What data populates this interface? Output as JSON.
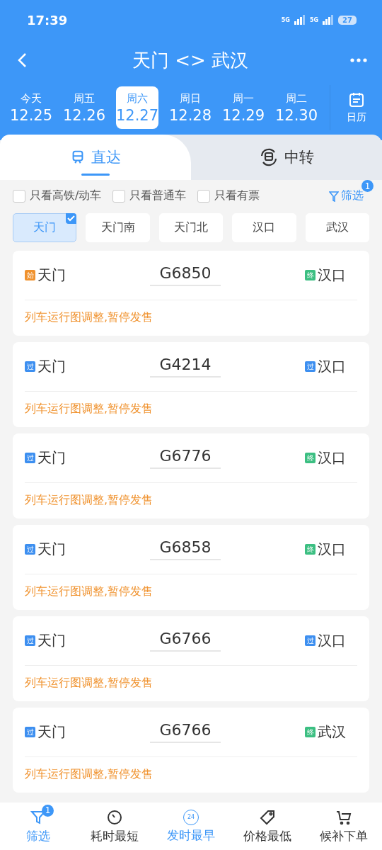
{
  "status_bar": {
    "time": "17:39",
    "network": [
      "5G",
      "5G"
    ],
    "battery": "27"
  },
  "header": {
    "title": "天门 <> 武汉"
  },
  "dates": [
    {
      "weekday": "今天",
      "date": "12.25",
      "selected": false
    },
    {
      "weekday": "周五",
      "date": "12.26",
      "selected": false
    },
    {
      "weekday": "周六",
      "date": "12.27",
      "selected": true
    },
    {
      "weekday": "周日",
      "date": "12.28",
      "selected": false
    },
    {
      "weekday": "周一",
      "date": "12.29",
      "selected": false
    },
    {
      "weekday": "周二",
      "date": "12.30",
      "selected": false
    }
  ],
  "calendar_button": "日历",
  "mode_tabs": [
    {
      "label": "直达",
      "kind": "direct",
      "selected": true
    },
    {
      "label": "中转",
      "kind": "transfer",
      "selected": false
    }
  ],
  "filters": [
    {
      "label": "只看高铁/动车",
      "checked": false
    },
    {
      "label": "只看普通车",
      "checked": false
    },
    {
      "label": "只看有票",
      "checked": false
    }
  ],
  "filter_link": {
    "label": "筛选",
    "badge": "1"
  },
  "stations": [
    {
      "label": "天门",
      "selected": true
    },
    {
      "label": "天门南",
      "selected": false
    },
    {
      "label": "天门北",
      "selected": false
    },
    {
      "label": "汉口",
      "selected": false
    },
    {
      "label": "武汉",
      "selected": false
    }
  ],
  "trains": [
    {
      "from": {
        "badge": "始",
        "color": "#f0922e",
        "name": "天门"
      },
      "number": "G6850",
      "to": {
        "badge": "终",
        "color": "#3cbf82",
        "name": "汉口"
      },
      "notice": "列车运行图调整,暂停发售"
    },
    {
      "from": {
        "badge": "过",
        "color": "#3d8ff0",
        "name": "天门"
      },
      "number": "G4214",
      "to": {
        "badge": "过",
        "color": "#3d8ff0",
        "name": "汉口"
      },
      "notice": "列车运行图调整,暂停发售"
    },
    {
      "from": {
        "badge": "过",
        "color": "#3d8ff0",
        "name": "天门"
      },
      "number": "G6776",
      "to": {
        "badge": "终",
        "color": "#3cbf82",
        "name": "汉口"
      },
      "notice": "列车运行图调整,暂停发售"
    },
    {
      "from": {
        "badge": "过",
        "color": "#3d8ff0",
        "name": "天门"
      },
      "number": "G6858",
      "to": {
        "badge": "终",
        "color": "#3cbf82",
        "name": "汉口"
      },
      "notice": "列车运行图调整,暂停发售"
    },
    {
      "from": {
        "badge": "过",
        "color": "#3d8ff0",
        "name": "天门"
      },
      "number": "G6766",
      "to": {
        "badge": "过",
        "color": "#3d8ff0",
        "name": "汉口"
      },
      "notice": "列车运行图调整,暂停发售"
    },
    {
      "from": {
        "badge": "过",
        "color": "#3d8ff0",
        "name": "天门"
      },
      "number": "G6766",
      "to": {
        "badge": "终",
        "color": "#3cbf82",
        "name": "武汉"
      },
      "notice": "列车运行图调整,暂停发售"
    }
  ],
  "bottom_nav": [
    {
      "label": "筛选",
      "kind": "filter",
      "badge": "1",
      "selected": true
    },
    {
      "label": "耗时最短",
      "kind": "duration",
      "selected": false
    },
    {
      "label": "发时最早",
      "kind": "earliest",
      "icon_text": "24",
      "selected": true
    },
    {
      "label": "价格最低",
      "kind": "price",
      "selected": false
    },
    {
      "label": "候补下单",
      "kind": "cart",
      "selected": false
    }
  ]
}
